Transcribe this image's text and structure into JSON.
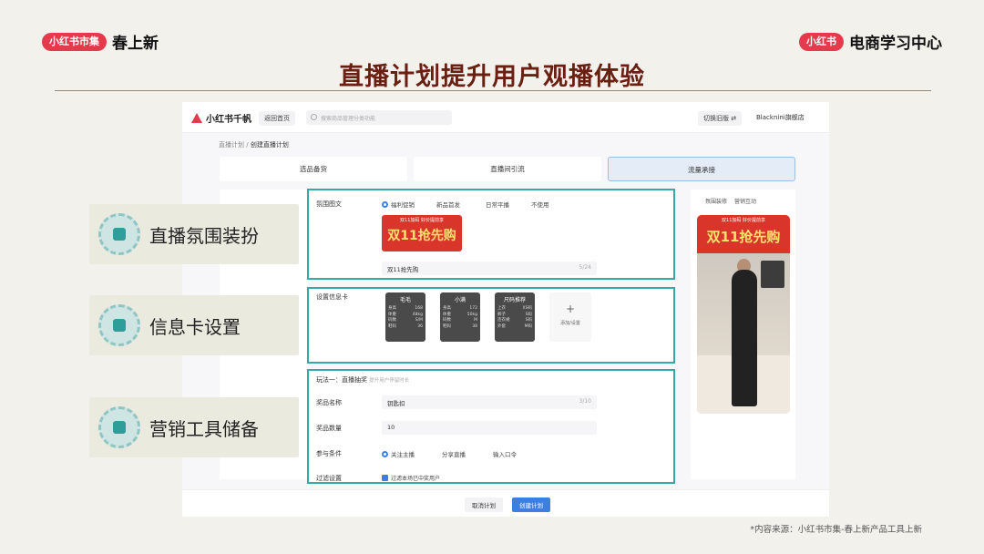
{
  "brand_left": {
    "pill": "小红书市集",
    "text": "春上新"
  },
  "brand_right": {
    "pill": "小红书",
    "text": "电商学习中心"
  },
  "title": "直播计划提升用户观播体验",
  "app": {
    "logo": "小红书千帆",
    "home": "返回首页",
    "search_placeholder": "搜索商品管理分类功能",
    "switch": "切换旧版 ⇄",
    "shop": "Blacknini旗舰店",
    "breadcrumb": {
      "parent": "直播计划 /",
      "current": "创建直播计划"
    },
    "steps": [
      "选品备货",
      "直播间引流",
      "流量承接"
    ],
    "right_tabs": [
      "氛围装修",
      "营销互动"
    ],
    "preview_banner_top": "双11加码 好价提前享",
    "preview_banner": "双11抢先购",
    "atmosphere": {
      "label": "氛围图文",
      "options": [
        "福利促销",
        "新品首发",
        "日常平播",
        "不使用"
      ],
      "sticker_top": "双11加码 好价提前享",
      "sticker": "双11抢先购",
      "text_value": "双11抢先购",
      "count": "5/24"
    },
    "info": {
      "label": "设置信息卡",
      "cards": [
        {
          "title": "毛毛",
          "rows": [
            [
              "身高",
              "168"
            ],
            [
              "体重",
              "48kg"
            ],
            [
              "码数",
              "S/M"
            ],
            [
              "鞋码",
              "36"
            ]
          ]
        },
        {
          "title": "小满",
          "rows": [
            [
              "身高",
              "172"
            ],
            [
              "体重",
              "50kg"
            ],
            [
              "码数",
              "M"
            ],
            [
              "鞋码",
              "38"
            ]
          ]
        },
        {
          "title": "尺码推荐",
          "rows": [
            [
              "上衣",
              "XS码"
            ],
            [
              "裤子",
              "S码"
            ],
            [
              "连衣裙",
              "S码"
            ],
            [
              "外套",
              "M码"
            ]
          ]
        }
      ],
      "add_label": "添加/设置"
    },
    "marketing": {
      "header": "玩法一：直播抽奖",
      "header_sub": "提升用户停留时长",
      "prize_name_label": "奖品名称",
      "prize_name_value": "钥匙扣",
      "prize_name_count": "3/10",
      "prize_qty_label": "奖品数量",
      "prize_qty_value": "10",
      "condition_label": "参与条件",
      "conditions": [
        "关注主播",
        "分享直播",
        "输入口令"
      ],
      "filter_label": "过滤设置",
      "filter_option": "过滤本场已中奖用户"
    },
    "cancel": "取消计划",
    "create": "创建计划"
  },
  "features": [
    "直播氛围装扮",
    "信息卡设置",
    "营销工具储备"
  ],
  "source": "*内容来源：小红书市集-春上新产品工具上新"
}
